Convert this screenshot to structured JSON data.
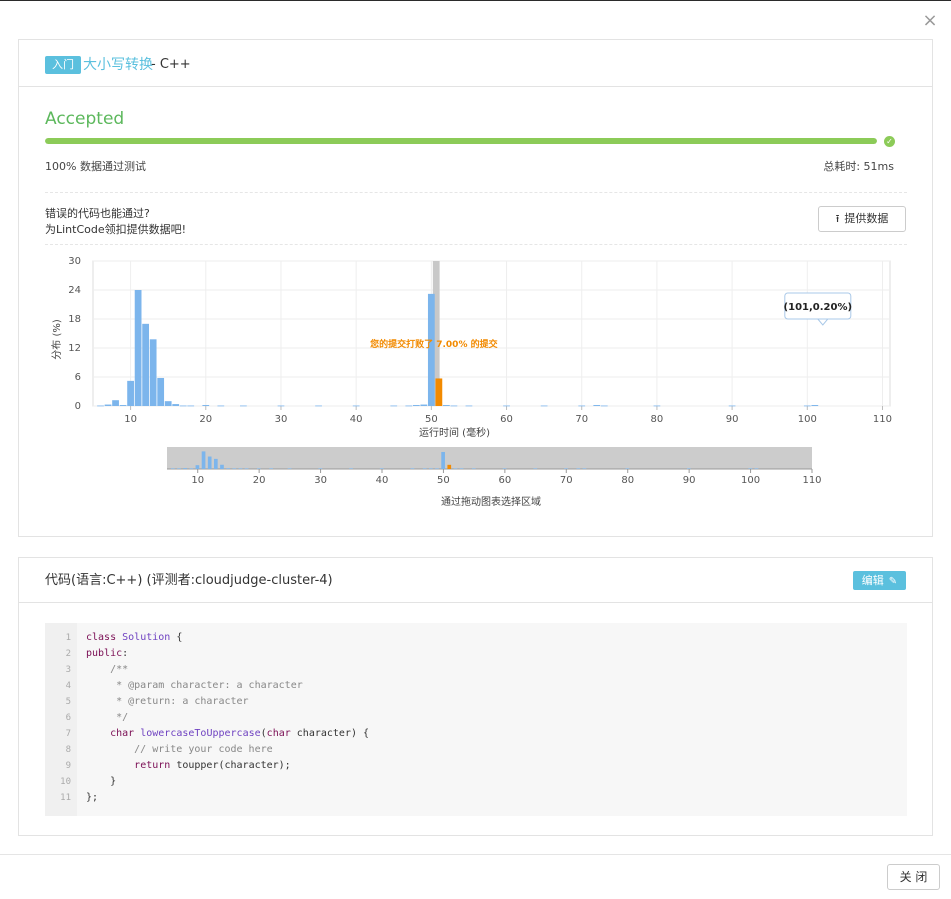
{
  "dialog": {
    "close_icon": "×",
    "close_label": "关 闭"
  },
  "header": {
    "level_badge": "入门",
    "problem_title": "大小写转换",
    "lang_suffix": " - C++"
  },
  "result": {
    "status": "Accepted",
    "progress": 1.0,
    "pass_text": "100%  数据通过测试",
    "time_text": "总耗时: 51ms",
    "wrong_line_1": "错误的代码也能通过?",
    "wrong_line_2": "为LintCode领扣提供数据吧!",
    "provide_label": "提供数据",
    "provide_icon": "upload-icon"
  },
  "colors": {
    "accent": "#5bc0de",
    "success": "#5cb85c",
    "progress": "#8ccb58",
    "bar": "#7cb5ec",
    "highlight": "#f28a00",
    "band": "#c8c8c8"
  },
  "chart_data": {
    "type": "bar",
    "ylabel": "分布 (%)",
    "xlabel": "运行时间 (毫秒)",
    "xlim": [
      5,
      111
    ],
    "ylim": [
      0,
      30
    ],
    "yticks": [
      "0",
      "6",
      "12",
      "18",
      "24",
      "30"
    ],
    "xticks": [
      "10",
      "20",
      "30",
      "40",
      "50",
      "60",
      "70",
      "80",
      "90",
      "100",
      "110"
    ],
    "nav_xticks": [
      "10",
      "20",
      "30",
      "40",
      "50",
      "60",
      "70",
      "80",
      "90",
      "100",
      "110"
    ],
    "x": [
      6,
      7,
      8,
      9,
      10,
      11,
      12,
      13,
      14,
      15,
      16,
      17,
      18,
      20,
      22,
      25,
      30,
      35,
      40,
      45,
      47,
      48,
      49,
      50,
      51,
      52,
      53,
      55,
      60,
      65,
      70,
      72,
      73,
      80,
      90,
      100,
      101
    ],
    "values": [
      0.1,
      0.3,
      1.2,
      0.2,
      5.2,
      24.0,
      17.0,
      13.8,
      5.8,
      1.0,
      0.4,
      0.1,
      0.1,
      0.2,
      0.1,
      0.1,
      0.1,
      0.1,
      0.1,
      0.1,
      0.1,
      0.2,
      0.3,
      23.2,
      0.3,
      0.2,
      0.1,
      0.1,
      0.1,
      0.1,
      0.1,
      0.2,
      0.1,
      0.1,
      0.1,
      0.1,
      0.2
    ],
    "highlight": {
      "x": 51,
      "value": 5.7,
      "label": "您的提交打败了 7.00% 的提交"
    },
    "tooltip": "(101,0.20%)",
    "drag_hint": "通过拖动图表选择区域"
  },
  "code": {
    "title": "代码(语言:C++) (评测者:cloudjudge-cluster-4)",
    "edit_label": "编辑",
    "edit_icon": "pencil-icon",
    "lines": [
      {
        "n": "1",
        "t": "class Solution {"
      },
      {
        "n": "2",
        "t": "public:"
      },
      {
        "n": "3",
        "t": "    /**"
      },
      {
        "n": "4",
        "t": "     * @param character: a character"
      },
      {
        "n": "5",
        "t": "     * @return: a character"
      },
      {
        "n": "6",
        "t": "     */"
      },
      {
        "n": "7",
        "t": "    char lowercaseToUppercase(char character) {"
      },
      {
        "n": "8",
        "t": "        // write your code here"
      },
      {
        "n": "9",
        "t": "        return toupper(character);"
      },
      {
        "n": "10",
        "t": "    }"
      },
      {
        "n": "11",
        "t": "};"
      }
    ]
  }
}
